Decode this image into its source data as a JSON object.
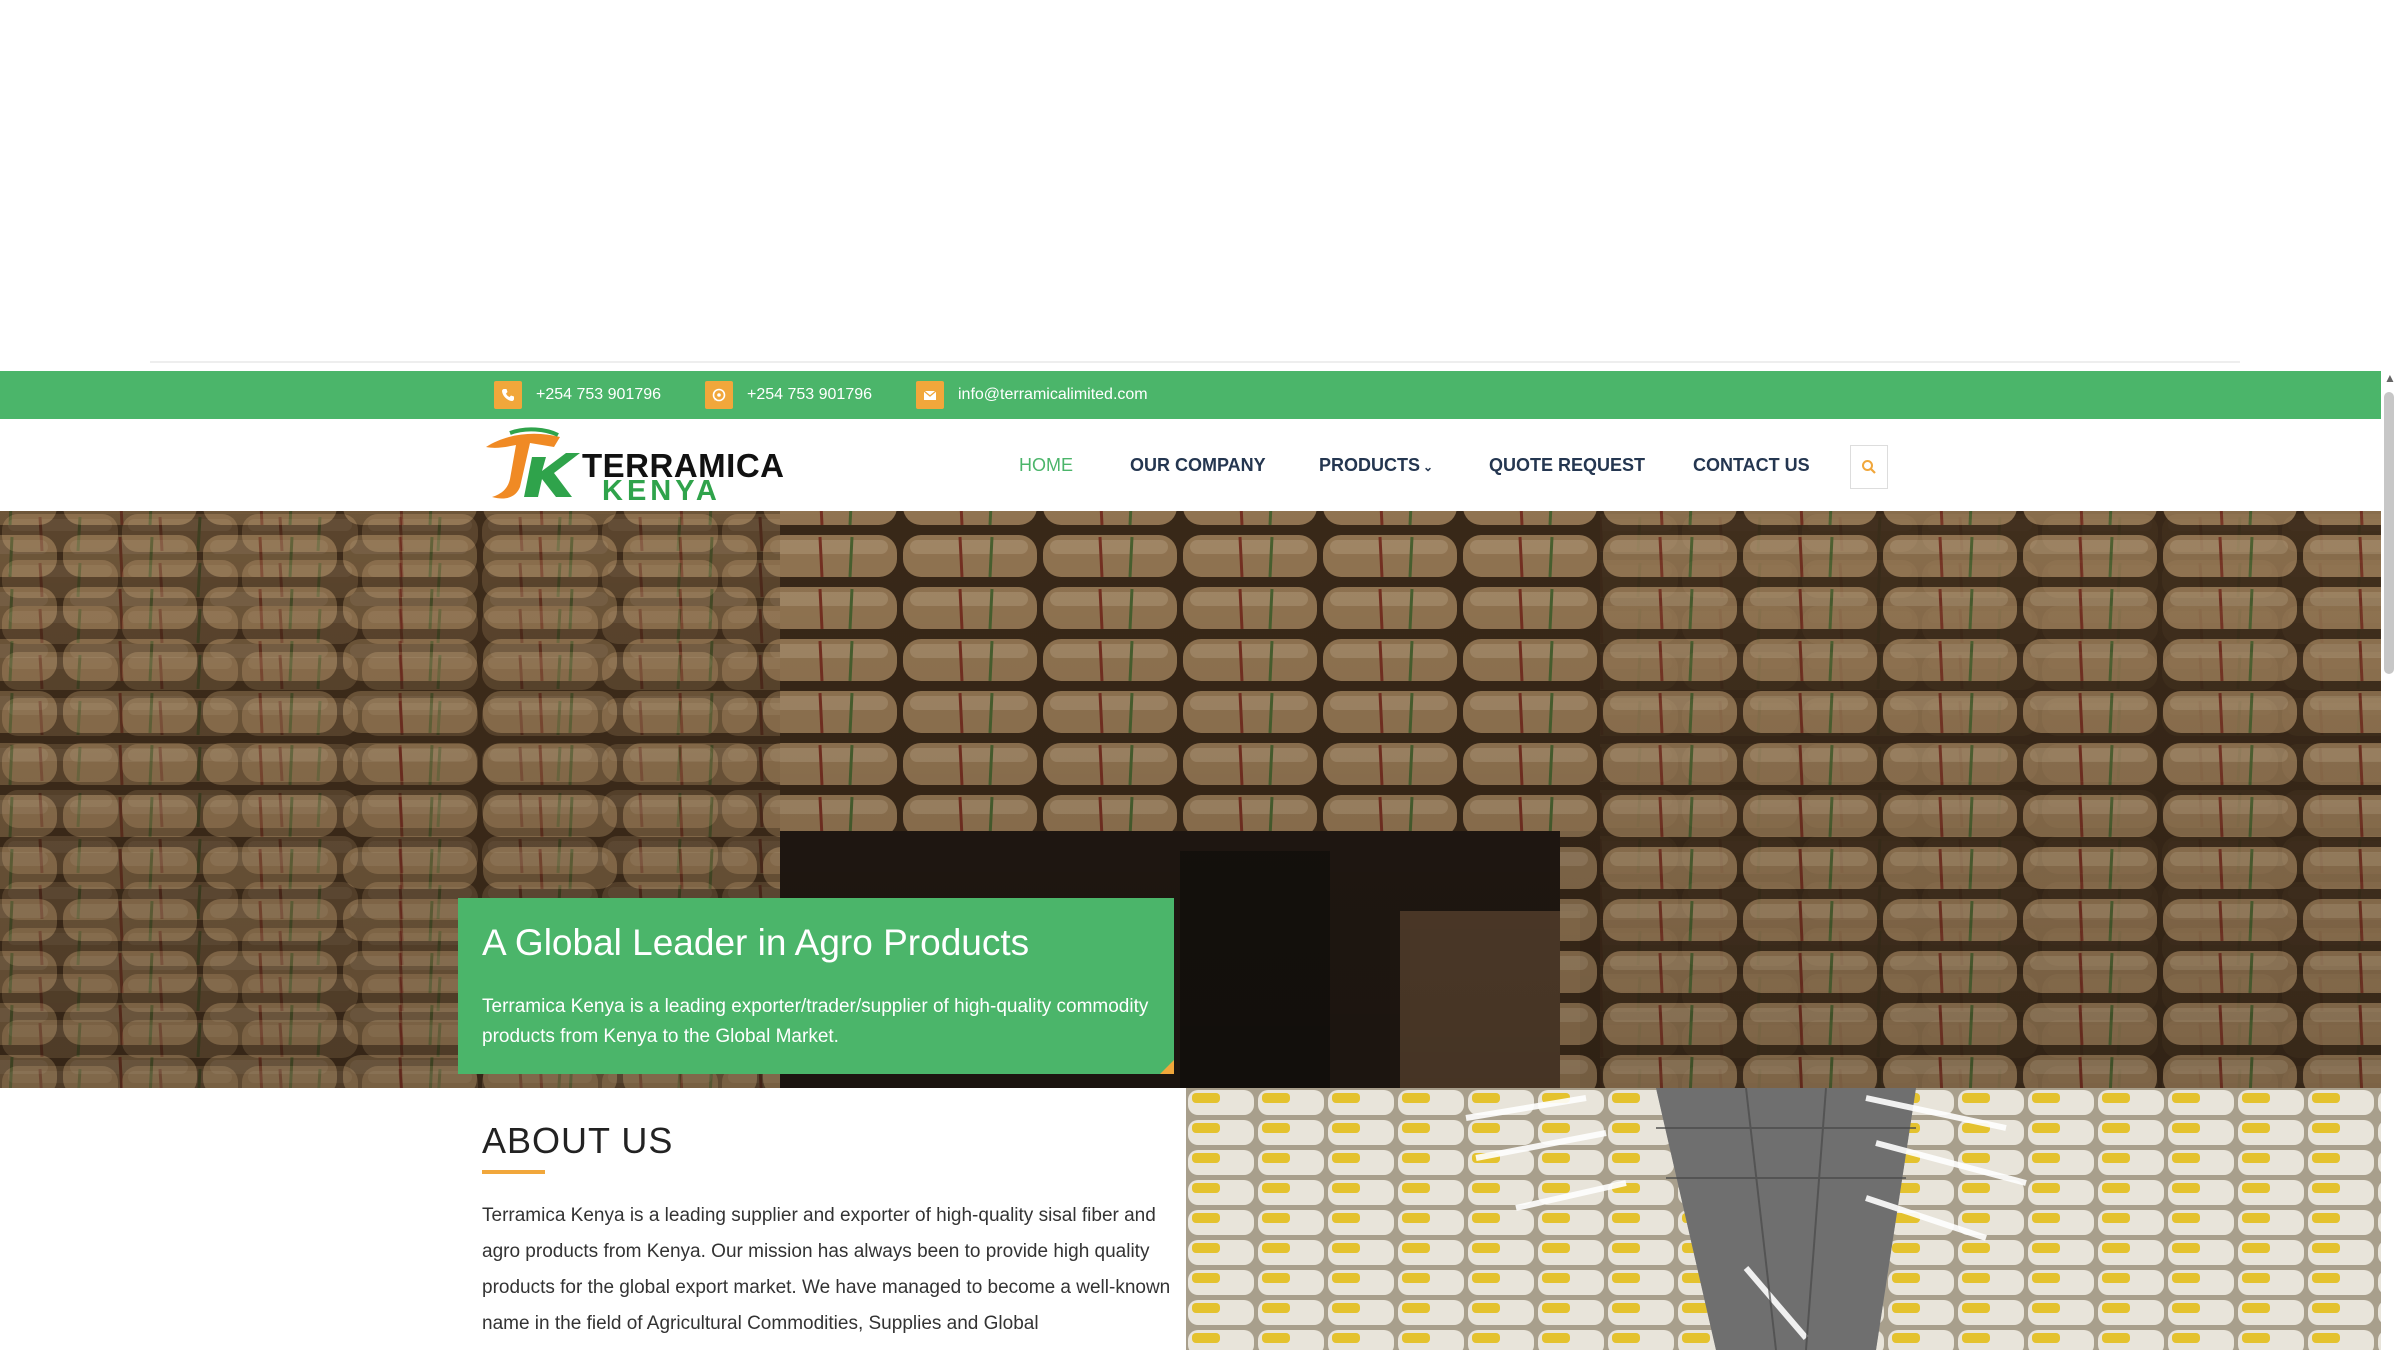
{
  "contact_bar": {
    "phone": "+254 753 901796",
    "whatsapp": "+254 753 901796",
    "email": "info@terramicalimited.com"
  },
  "logo": {
    "line1": "TERRAMICA",
    "line2": "KENYA",
    "mark": "TK"
  },
  "nav": {
    "home": "HOME",
    "company": "OUR COMPANY",
    "products": "PRODUCTS",
    "quote": "QUOTE REQUEST",
    "contact": "CONTACT US"
  },
  "hero": {
    "title": "A Global Leader in Agro Products",
    "text": "Terramica Kenya is a leading exporter/trader/supplier of high-quality commodity products from Kenya to the Global Market."
  },
  "about": {
    "title": "ABOUT US",
    "text": "Terramica Kenya is a leading supplier and exporter of high-quality sisal fiber and agro products from Kenya. Our mission has always been to provide high quality products for the global export market. We have managed to become a well-known name in the field of Agricultural Commodities, Supplies and Global"
  },
  "colors": {
    "green": "#4bb56a",
    "orange": "#f1a73b",
    "navy": "#243650"
  },
  "icons": [
    "phone-icon",
    "whatsapp-icon",
    "email-icon",
    "search-icon",
    "chevron-down-icon"
  ]
}
